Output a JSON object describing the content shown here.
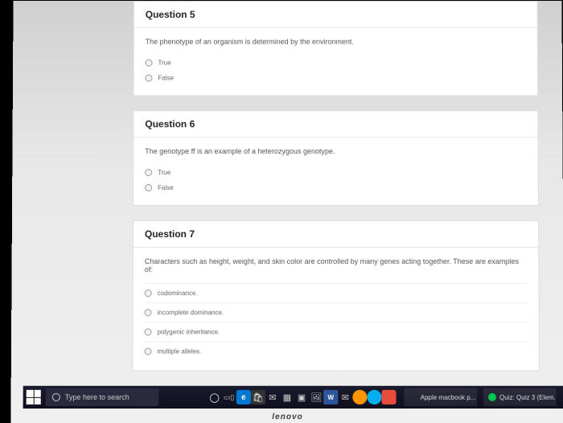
{
  "questions": [
    {
      "title": "Question 5",
      "prompt": "The phenotype of an organism is determined by the environment.",
      "options": [
        "True",
        "False"
      ]
    },
    {
      "title": "Question 6",
      "prompt": "The genotype ff is an example of a heterozygous genotype.",
      "options": [
        "True",
        "False"
      ]
    },
    {
      "title": "Question 7",
      "prompt": "Characters such as height, weight, and skin color are controlled by many genes acting together. These are examples of:",
      "options": [
        "codominance.",
        "incomplete dominance.",
        "polygenic inheritance.",
        "multiple alleles."
      ]
    }
  ],
  "taskbar": {
    "search_placeholder": "Type here to search",
    "tabs": [
      {
        "label": "Apple macbook p...",
        "icon_color": "#666"
      },
      {
        "label": "Quiz: Quiz 3 (Elem...",
        "icon_color": "#00c853"
      }
    ]
  },
  "brand": "lenovo"
}
